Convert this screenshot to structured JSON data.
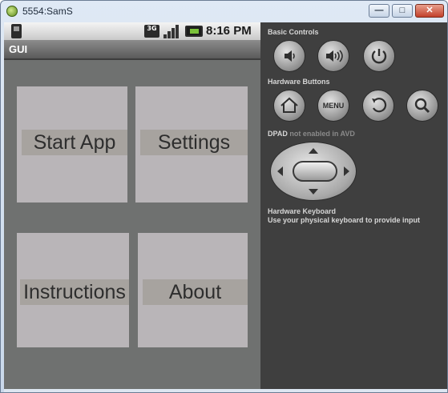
{
  "window": {
    "title": "5554:SamS",
    "minimize_glyph": "—",
    "maximize_glyph": "□",
    "close_glyph": "✕"
  },
  "statusbar": {
    "network_label": "3G",
    "time": "8:16 PM"
  },
  "app": {
    "title": "GUI",
    "tiles": [
      {
        "label": "Start App"
      },
      {
        "label": "Settings"
      },
      {
        "label": "Instructions"
      },
      {
        "label": "About"
      }
    ]
  },
  "controls": {
    "basic_label": "Basic Controls",
    "basic_buttons": [
      "volume-down-icon",
      "volume-up-icon",
      "power-icon"
    ],
    "hardware_label": "Hardware Buttons",
    "hardware_buttons": [
      "home-icon",
      "menu",
      "back-icon",
      "search-icon"
    ],
    "menu_label": "MENU",
    "dpad_label": "DPAD",
    "dpad_note": "not enabled in AVD",
    "keyboard_label": "Hardware Keyboard",
    "keyboard_note": "Use your physical keyboard to provide input"
  },
  "colors": {
    "screen_bg": "#6f7170",
    "tile_bg": "#b9b5b8",
    "label_bg": "#a7a39f",
    "panel_bg": "#3f3f3f",
    "battery_green": "#7ac23a"
  }
}
